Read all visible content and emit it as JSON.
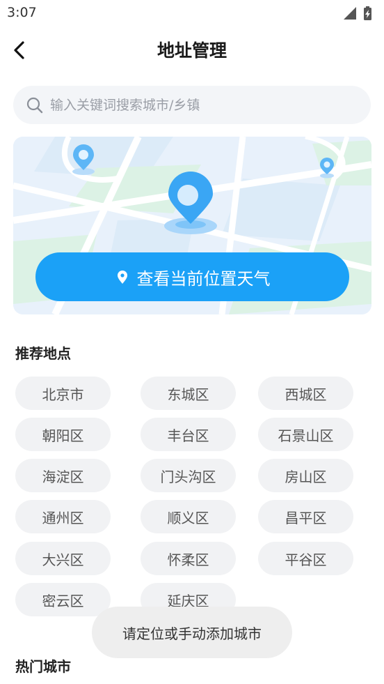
{
  "status_bar": {
    "time": "3:07",
    "icons": [
      "signal-icon",
      "battery-charging-icon"
    ]
  },
  "header": {
    "title": "地址管理",
    "back_icon": "chevron-left-icon"
  },
  "search": {
    "placeholder": "输入关键词搜索城市/乡镇",
    "icon": "search-icon"
  },
  "map_card": {
    "button_label": "查看当前位置天气",
    "button_icon": "location-pin-icon",
    "accent": "#1ba1f7"
  },
  "recommended": {
    "title": "推荐地点",
    "items": [
      "北京市",
      "东城区",
      "西城区",
      "朝阳区",
      "丰台区",
      "石景山区",
      "海淀区",
      "门头沟区",
      "房山区",
      "通州区",
      "顺义区",
      "昌平区",
      "大兴区",
      "怀柔区",
      "平谷区",
      "密云区",
      "延庆区"
    ]
  },
  "hot_cities": {
    "title": "热门城市"
  },
  "toast": {
    "message": "请定位或手动添加城市"
  }
}
